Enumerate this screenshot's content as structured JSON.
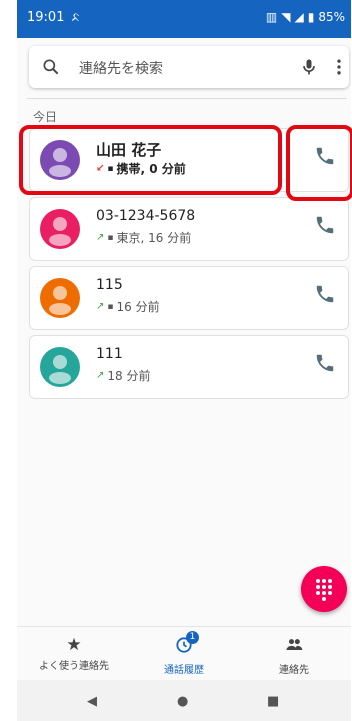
{
  "status": {
    "time": "19:01",
    "battery": "85%"
  },
  "search": {
    "placeholder": "連絡先を検索"
  },
  "section": {
    "today": "今日"
  },
  "calls": [
    {
      "name": "山田 花子",
      "detail": "携帯, 0 分前",
      "avatar_color": "#7b4bb3",
      "direction": "missed",
      "bold": true
    },
    {
      "name": "03-1234-5678",
      "detail": "東京, 16 分前",
      "avatar_color": "#e91e63",
      "direction": "outgoing",
      "bold": false
    },
    {
      "name": "115",
      "detail": "16 分前",
      "avatar_color": "#ef6c00",
      "direction": "outgoing",
      "bold": false
    },
    {
      "name": "111",
      "detail": "18 分前",
      "avatar_color": "#26a69a",
      "direction": "outgoing",
      "bold": false
    }
  ],
  "nav": {
    "favorites": "よく使う連絡先",
    "history": "通話履歴",
    "history_badge": "1",
    "contacts": "連絡先"
  },
  "colors": {
    "accent": "#1565c0",
    "fab": "#f50057",
    "highlight": "#e30613",
    "missed": "#e53935",
    "outgoing": "#43a047"
  },
  "icons": [
    "search-icon",
    "mic-icon",
    "more-vert-icon",
    "phone-icon",
    "dialpad-icon",
    "star-icon",
    "history-icon",
    "people-icon"
  ]
}
